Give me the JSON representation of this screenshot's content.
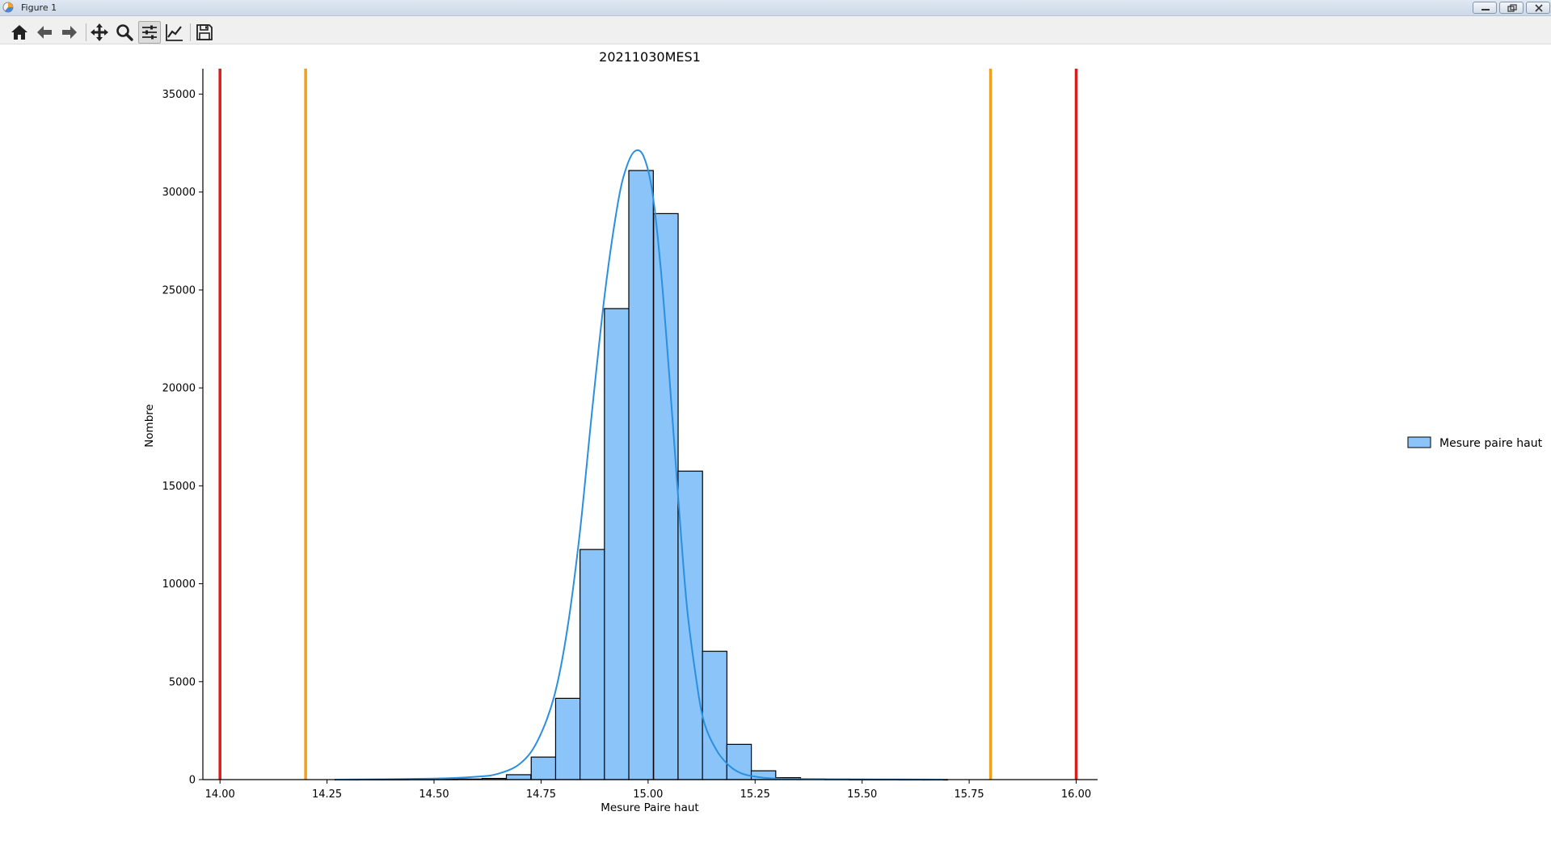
{
  "window": {
    "title": "Figure 1",
    "controls": [
      "minimize",
      "restore",
      "close"
    ]
  },
  "toolbar": {
    "buttons": [
      {
        "icon": "home-icon",
        "action": "home"
      },
      {
        "icon": "arrow-left-icon",
        "action": "back"
      },
      {
        "icon": "arrow-right-icon",
        "action": "forward"
      },
      {
        "icon": "move-icon",
        "action": "pan"
      },
      {
        "icon": "search-icon",
        "action": "zoom"
      },
      {
        "icon": "sliders-icon",
        "action": "configure subplots",
        "active": true
      },
      {
        "icon": "line-chart-icon",
        "action": "edit axis"
      },
      {
        "icon": "save-icon",
        "action": "save"
      }
    ]
  },
  "chart_data": {
    "type": "bar",
    "title": "20211030MES1",
    "xlabel": "Mesure Paire haut",
    "ylabel": "Nombre",
    "xlim": [
      13.96,
      16.05
    ],
    "ylim": [
      0,
      36300
    ],
    "xticks": [
      "14.00",
      "14.25",
      "14.50",
      "14.75",
      "15.00",
      "15.25",
      "15.50",
      "15.75",
      "16.00"
    ],
    "xtick_values": [
      14.0,
      14.25,
      14.5,
      14.75,
      15.0,
      15.25,
      15.5,
      15.75,
      16.0
    ],
    "yticks": [
      "0",
      "5000",
      "10000",
      "15000",
      "20000",
      "25000",
      "30000",
      "35000"
    ],
    "ytick_values": [
      0,
      5000,
      10000,
      15000,
      20000,
      25000,
      30000,
      35000
    ],
    "bin_width": 0.0572,
    "bins": [
      {
        "x0": 14.269,
        "value": 5
      },
      {
        "x0": 14.326,
        "value": 8
      },
      {
        "x0": 14.383,
        "value": 10
      },
      {
        "x0": 14.441,
        "value": 15
      },
      {
        "x0": 14.498,
        "value": 20
      },
      {
        "x0": 14.555,
        "value": 30
      },
      {
        "x0": 14.612,
        "value": 60
      },
      {
        "x0": 14.669,
        "value": 250
      },
      {
        "x0": 14.727,
        "value": 1150
      },
      {
        "x0": 14.784,
        "value": 4150
      },
      {
        "x0": 14.841,
        "value": 11750
      },
      {
        "x0": 14.898,
        "value": 24050
      },
      {
        "x0": 14.955,
        "value": 31100
      },
      {
        "x0": 15.013,
        "value": 28900
      },
      {
        "x0": 15.07,
        "value": 15750
      },
      {
        "x0": 15.127,
        "value": 6550
      },
      {
        "x0": 15.184,
        "value": 1800
      },
      {
        "x0": 15.241,
        "value": 450
      },
      {
        "x0": 15.299,
        "value": 100
      },
      {
        "x0": 15.356,
        "value": 40
      },
      {
        "x0": 15.413,
        "value": 20
      },
      {
        "x0": 15.47,
        "value": 10
      },
      {
        "x0": 15.527,
        "value": 8
      },
      {
        "x0": 15.585,
        "value": 5
      },
      {
        "x0": 15.642,
        "value": 3
      }
    ],
    "kde": {
      "x": [
        14.27,
        14.5,
        14.6,
        14.65,
        14.7,
        14.74,
        14.78,
        14.81,
        14.84,
        14.87,
        14.9,
        14.93,
        14.95,
        14.97,
        14.99,
        15.01,
        15.03,
        15.05,
        15.07,
        15.09,
        15.11,
        15.13,
        15.16,
        15.19,
        15.22,
        15.26,
        15.3,
        15.4,
        15.69
      ],
      "y": [
        0,
        50,
        150,
        300,
        800,
        1900,
        4200,
        7500,
        12500,
        19000,
        25000,
        29500,
        31300,
        32100,
        31800,
        30000,
        26000,
        20500,
        14500,
        9000,
        5500,
        3000,
        1500,
        700,
        300,
        120,
        50,
        20,
        0
      ]
    },
    "vlines": [
      {
        "x": 14.0,
        "color": "#dd1c1c"
      },
      {
        "x": 14.2,
        "color": "#f0a01a"
      },
      {
        "x": 15.8,
        "color": "#f0a01a"
      },
      {
        "x": 16.0,
        "color": "#dd1c1c"
      }
    ],
    "colors": {
      "bar_fill": "#8bc4f8",
      "bar_edge": "#000000",
      "kde_line": "#2a8fe0",
      "axis": "#000000"
    },
    "legend": {
      "entries": [
        "Mesure paire haut"
      ],
      "placement": "right"
    },
    "grid": false
  }
}
